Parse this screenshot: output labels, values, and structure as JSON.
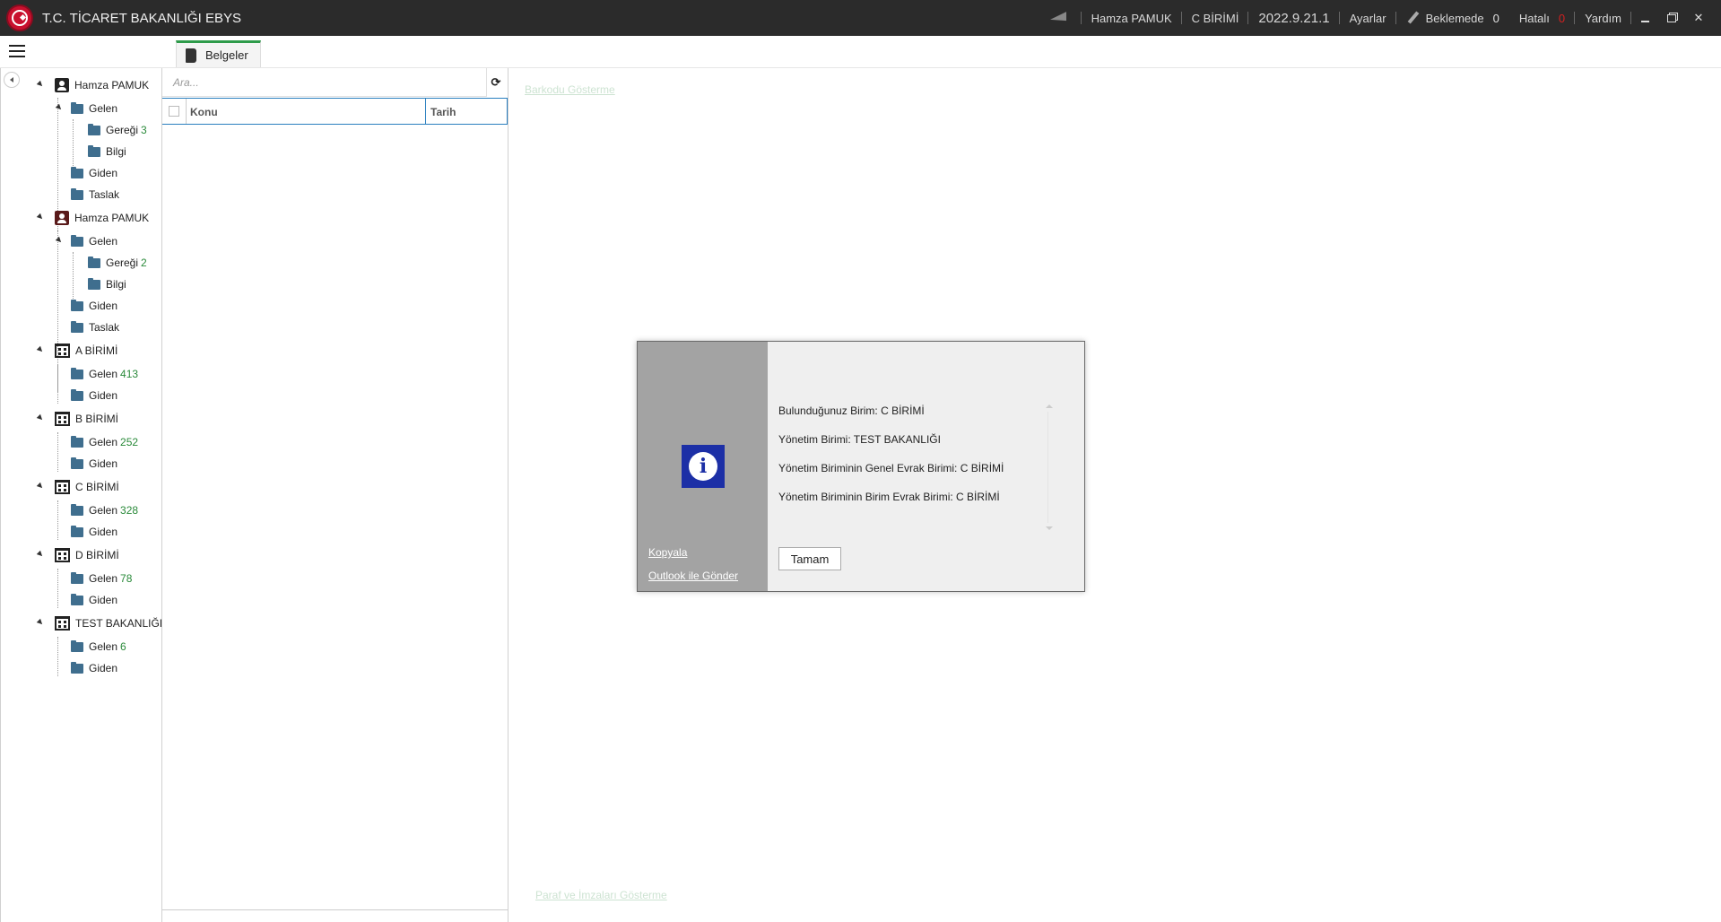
{
  "titlebar": {
    "title": "T.C. TİCARET BAKANLIĞI EBYS",
    "user": "Hamza PAMUK",
    "unit": "C BİRİMİ",
    "version": "2022.9.21.1",
    "settings": "Ayarlar",
    "pending_label": "Beklemede",
    "pending_count": "0",
    "error_label": "Hatalı",
    "error_count": "0",
    "help": "Yardım"
  },
  "tab": {
    "label": "Belgeler"
  },
  "tree": {
    "user1": {
      "label": "Hamza PAMUK",
      "gelen": "Gelen",
      "geregi": "Gereği",
      "geregi_count": "3",
      "bilgi": "Bilgi",
      "giden": "Giden",
      "taslak": "Taslak"
    },
    "user2": {
      "label": "Hamza PAMUK",
      "gelen": "Gelen",
      "geregi": "Gereği",
      "geregi_count": "2",
      "bilgi": "Bilgi",
      "giden": "Giden",
      "taslak": "Taslak"
    },
    "units": [
      {
        "label": "A BİRİMİ",
        "gelen": "Gelen",
        "count": "413",
        "giden": "Giden"
      },
      {
        "label": "B BİRİMİ",
        "gelen": "Gelen",
        "count": "252",
        "giden": "Giden"
      },
      {
        "label": "C BİRİMİ",
        "gelen": "Gelen",
        "count": "328",
        "giden": "Giden"
      },
      {
        "label": "D BİRİMİ",
        "gelen": "Gelen",
        "count": "78",
        "giden": "Giden"
      },
      {
        "label": "TEST BAKANLIĞI",
        "gelen": "Gelen",
        "count": "6",
        "giden": "Giden"
      }
    ]
  },
  "list": {
    "search_placeholder": "Ara...",
    "col_konu": "Konu",
    "col_tarih": "Tarih"
  },
  "preview": {
    "barcode_link": "Barkodu Gösterme",
    "signatures_link": "Paraf ve İmzaları Gösterme"
  },
  "dialog": {
    "lines": [
      "Bulunduğunuz Birim: C BİRİMİ",
      "Yönetim Birimi: TEST BAKANLIĞI",
      "Yönetim Biriminin Genel Evrak Birimi: C BİRİMİ",
      "Yönetim Biriminin Birim Evrak Birimi: C BİRİMİ"
    ],
    "copy_link": "Kopyala",
    "outlook_link": "Outlook ile Gönder",
    "ok_label": "Tamam"
  },
  "colors": {
    "titlebar_bg": "#2b2b2b",
    "tab_accent": "#2e9b4a",
    "count_green": "#2a8a3a",
    "error_red": "#d42020",
    "info_blue": "#1c2fa6",
    "folder_blue": "#3f6e8e"
  }
}
